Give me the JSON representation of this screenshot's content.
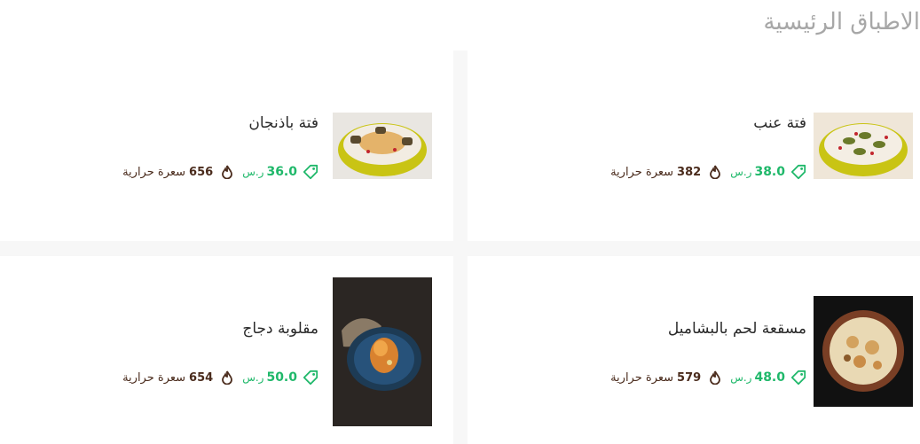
{
  "section": {
    "title": "الاطباق الرئيسية"
  },
  "dishes": [
    {
      "name": "فتة عنب",
      "price": "38.0",
      "currency": "ر.س",
      "calories": "382",
      "calories_unit": "سعرة حرارية"
    },
    {
      "name": "فتة باذنجان",
      "price": "36.0",
      "currency": "ر.س",
      "calories": "656",
      "calories_unit": "سعرة حرارية"
    },
    {
      "name": "مسقعة لحم بالبشاميل",
      "price": "48.0",
      "currency": "ر.س",
      "calories": "579",
      "calories_unit": "سعرة حرارية"
    },
    {
      "name": "مقلوبة دجاج",
      "price": "50.0",
      "currency": "ر.س",
      "calories": "654",
      "calories_unit": "سعرة حرارية"
    }
  ],
  "icons": {
    "price": "price-tag-icon",
    "calories": "flame-icon"
  },
  "colors": {
    "price": "#1fb86a",
    "calories": "#4a2b1c",
    "title": "#a7a7a7"
  }
}
